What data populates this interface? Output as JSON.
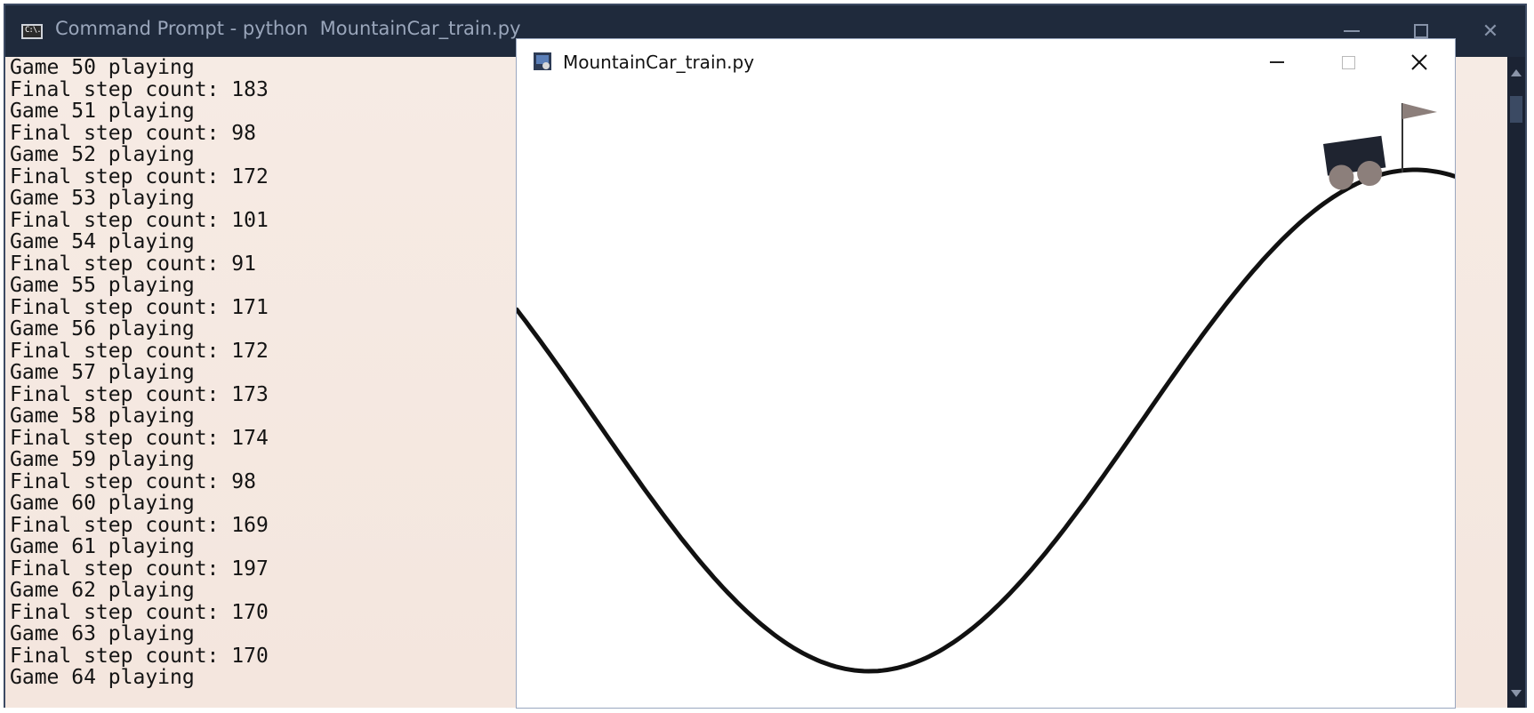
{
  "console_window": {
    "title": "Command Prompt - python  MountainCar_train.py",
    "icon": "cmd-icon",
    "icon_text": "C:\\.",
    "lines": [
      "Game 50 playing",
      "Final step count: 183",
      "Game 51 playing",
      "Final step count: 98",
      "Game 52 playing",
      "Final step count: 172",
      "Game 53 playing",
      "Final step count: 101",
      "Game 54 playing",
      "Final step count: 91",
      "Game 55 playing",
      "Final step count: 171",
      "Game 56 playing",
      "Final step count: 172",
      "Game 57 playing",
      "Final step count: 173",
      "Game 58 playing",
      "Final step count: 174",
      "Game 59 playing",
      "Final step count: 98",
      "Game 60 playing",
      "Final step count: 169",
      "Game 61 playing",
      "Final step count: 197",
      "Game 62 playing",
      "Final step count: 170",
      "Game 63 playing",
      "Final step count: 170",
      "Game 64 playing"
    ]
  },
  "game_window": {
    "title": "MountainCar_train.py",
    "icon": "pygame-icon",
    "colors": {
      "track": "#111111",
      "car_body": "#1f2430",
      "wheels": "#8c7f7b",
      "flag": "#8c7f7b"
    }
  }
}
